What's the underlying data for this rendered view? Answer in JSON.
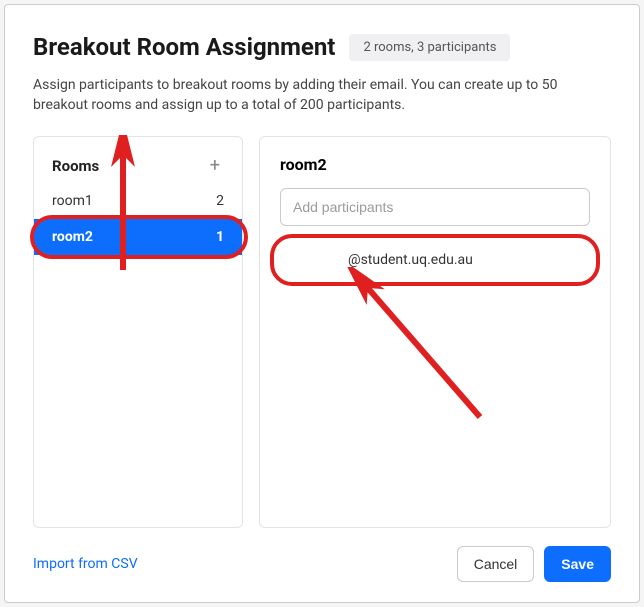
{
  "header": {
    "title": "Breakout Room Assignment",
    "badge": "2 rooms, 3 participants"
  },
  "description": "Assign participants to breakout rooms by adding their email. You can create up to 50 breakout rooms and assign up to a total of 200 participants.",
  "rooms_panel": {
    "header": "Rooms",
    "add_label": "+",
    "items": [
      {
        "name": "room1",
        "count": "2",
        "selected": false
      },
      {
        "name": "room2",
        "count": "1",
        "selected": true
      }
    ]
  },
  "detail": {
    "title": "room2",
    "input_placeholder": "Add participants",
    "participants": [
      {
        "visible_suffix": "@student.uq.edu.au"
      }
    ]
  },
  "footer": {
    "import_label": "Import from CSV",
    "cancel_label": "Cancel",
    "save_label": "Save"
  }
}
